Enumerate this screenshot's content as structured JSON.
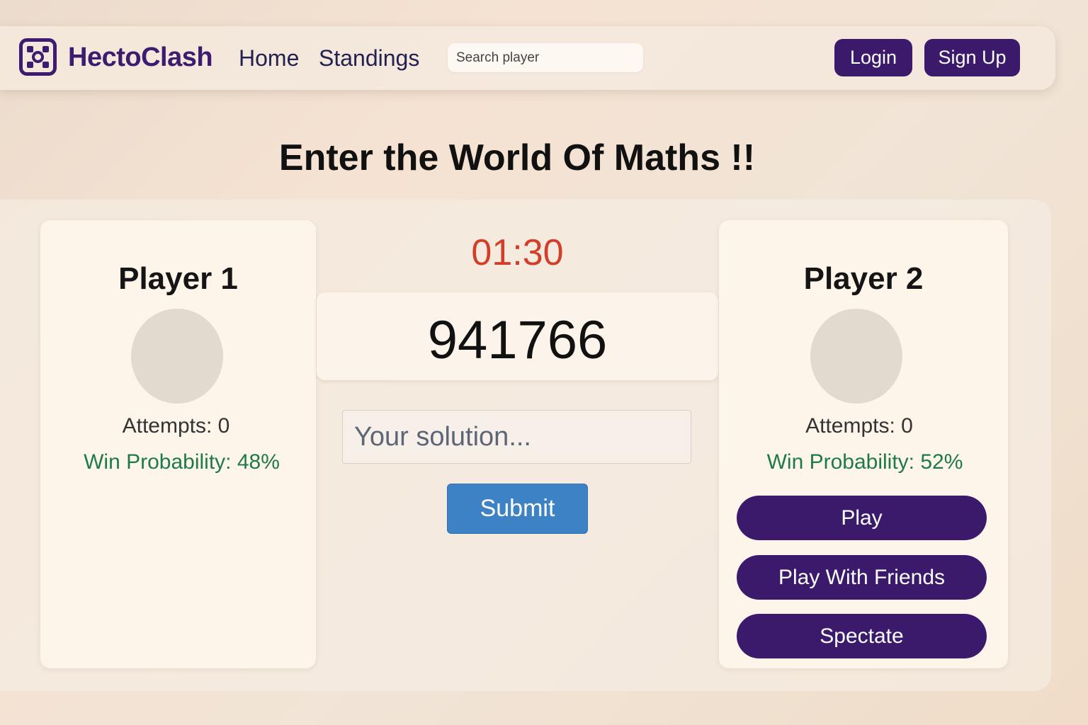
{
  "app": {
    "brand": "HectoClash",
    "logo_icon": "hexagon-grid-icon"
  },
  "nav": {
    "home": "Home",
    "standings": "Standings",
    "search_placeholder": "Search player",
    "login": "Login",
    "signup": "Sign Up"
  },
  "headline": "Enter the World Of Maths !!",
  "game": {
    "timer": "01:30",
    "puzzle": "941766",
    "solution_placeholder": "Your solution...",
    "submit": "Submit"
  },
  "player1": {
    "title": "Player 1",
    "attempts": "Attempts: 0",
    "win_probability": "Win Probability: 48%"
  },
  "player2": {
    "title": "Player 2",
    "attempts": "Attempts: 0",
    "win_probability": "Win Probability: 52%"
  },
  "actions": {
    "play": "Play",
    "play_with_friends": "Play With Friends",
    "spectate": "Spectate"
  },
  "colors": {
    "brand_purple": "#3b1a6c",
    "timer_red": "#d13f2a",
    "win_green": "#1f7a4a",
    "submit_blue": "#3d82c4"
  }
}
